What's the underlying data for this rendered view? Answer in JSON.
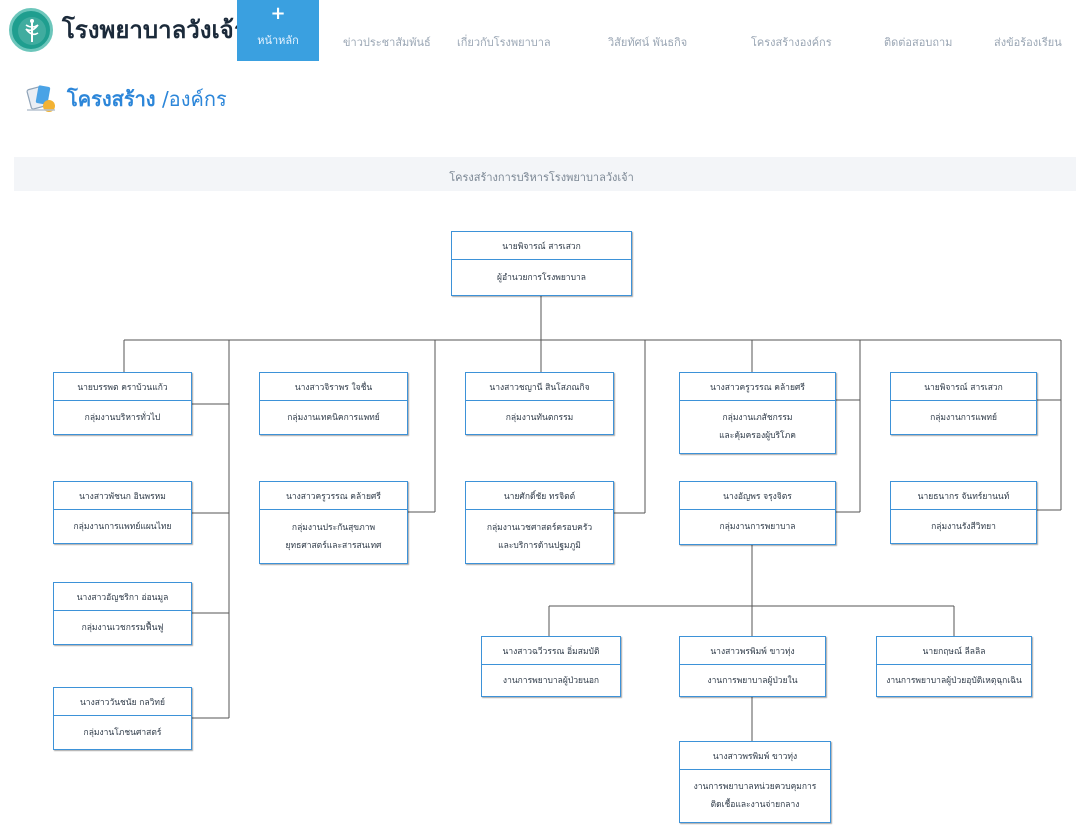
{
  "header": {
    "site_title": "โรงพยาบาลวังเจ้า",
    "nav": [
      {
        "label": "หน้าหลัก",
        "active": true
      },
      {
        "label": "ข่าวประชาสัมพันธ์"
      },
      {
        "label": "เกี่ยวกับโรงพยาบาล"
      },
      {
        "label": "วิสัยทัศน์ พันธกิจ"
      },
      {
        "label": "โครงสร้างองค์กร"
      },
      {
        "label": "ติดต่อสอบถาม"
      },
      {
        "label": "ส่งข้อร้องเรียน"
      }
    ],
    "home_icon": "plus-icon",
    "logo_icon": "ministry-of-public-health-logo"
  },
  "page": {
    "heading_main": "โครงสร้าง",
    "heading_sub": "/องค์กร",
    "heading_icon": "org-chart-icon"
  },
  "chart": {
    "title": "โครงสร้างการบริหารโรงพยาบาลวังเจ้า",
    "director": {
      "name": "นายพิจารณ์ สารเสวก",
      "role": "ผู้อำนวยการโรงพยาบาล"
    },
    "units": [
      {
        "name": "นายบรรพต คราบ้วนแก้ว",
        "role": "กลุ่มงานบริหารทั่วไป"
      },
      {
        "name": "นางสาวจิราพร ใจชื่น",
        "role": "กลุ่มงานเทคนิคการแพทย์"
      },
      {
        "name": "นางสาวชญานี สินโสภณกิจ",
        "role": "กลุ่มงานทันตกรรม"
      },
      {
        "name": "นางสาวครูวรรณ คล้ายศรี",
        "role": "กลุ่มงานเภสัชกรรม\nและคุ้มครองผู้บริโภค"
      },
      {
        "name": "นายพิจารณ์ สารเสวก",
        "role": "กลุ่มงานการแพทย์"
      },
      {
        "name": "นางสาวพัชนก อินพรหม",
        "role": "กลุ่มงานการแพทย์แผนไทย"
      },
      {
        "name": "นางสาวครูวรรณ คล้ายศรี",
        "role": "กลุ่มงานประกันสุขภาพ\nยุทธศาสตร์และสารสนเทศ"
      },
      {
        "name": "นายศักดิ์ชัย ทรจิตต์",
        "role": "กลุ่มงานเวชศาสตร์ครอบครัว\nและบริการด้านปฐมภูมิ"
      },
      {
        "name": "นางอัญพร จรุงจิตร",
        "role": "กลุ่มงานการพยาบาล"
      },
      {
        "name": "นายธนากร จันทร์ยานนท์",
        "role": "กลุ่มงานรังสีวิทยา"
      },
      {
        "name": "นางสาวอัญชริกา อ่อนมูล",
        "role": "กลุ่มงานเวชกรรมฟื้นฟู"
      },
      {
        "name": "นางสาววันชนัย กลวิทย์",
        "role": "กลุ่มงานโภชนศาสตร์"
      }
    ],
    "nursing_units": [
      {
        "name": "นางสาวฉวีวรรณ อิ่มสมบัติ",
        "role": "งานการพยาบาลผู้ป่วยนอก"
      },
      {
        "name": "นางสาวพรพิมพ์ ขาวทุ่ง",
        "role": "งานการพยาบาลผู้ป่วยใน"
      },
      {
        "name": "นายกฤษณ์ ลีลลิล",
        "role": "งานการพยาบาลผู้ป่วยอุบัติเหตุฉุกเฉิน"
      }
    ],
    "infection_unit": {
      "name": "นางสาวพรพิมพ์ ขาวทุ่ง",
      "role": "งานการพยาบาลหน่วยควบคุมการ\nติดเชื้อและงานจ่ายกลาง"
    },
    "colors": {
      "accent": "#3aa0e0",
      "box_border": "#3d92d8",
      "heading": "#2c86d9"
    }
  }
}
